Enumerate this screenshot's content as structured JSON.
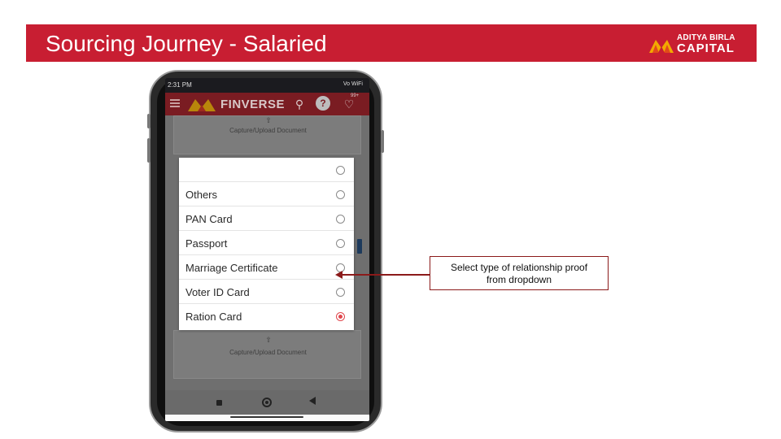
{
  "slide": {
    "title": "Sourcing Journey - Salaried",
    "brand": {
      "line1": "ADITYA BIRLA",
      "line2": "CAPITAL"
    },
    "colors": {
      "header": "#c81e32",
      "callout_border": "#8b1a1a",
      "selected_radio": "#e0474d"
    }
  },
  "phone": {
    "status_bar": {
      "time": "2:31 PM",
      "right": "Vo WiFi"
    },
    "app_bar": {
      "title": "FINVERSE",
      "badge": "99+"
    },
    "background": {
      "upload_label_top": "Capture/Upload Document",
      "upload_label_bottom": "Capture/Upload Document"
    },
    "dropdown": {
      "options": [
        {
          "label": "",
          "selected": false
        },
        {
          "label": "Others",
          "selected": false
        },
        {
          "label": "PAN Card",
          "selected": false
        },
        {
          "label": "Passport",
          "selected": false
        },
        {
          "label": "Marriage Certificate",
          "selected": false
        },
        {
          "label": "Voter ID Card",
          "selected": false
        },
        {
          "label": "Ration Card",
          "selected": true
        }
      ]
    }
  },
  "callout": {
    "line1": "Select type of relationship proof",
    "line2": "from dropdown"
  }
}
